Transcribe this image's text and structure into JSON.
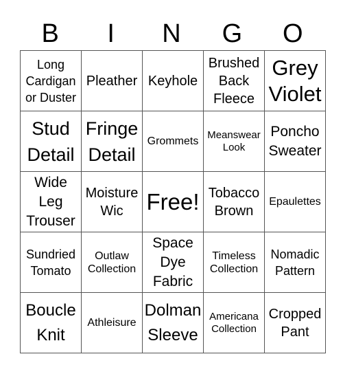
{
  "header": [
    "B",
    "I",
    "N",
    "G",
    "O"
  ],
  "rows": [
    [
      "Long Cardigan or Duster",
      "Pleather",
      "Keyhole",
      "Brushed Back Fleece",
      "Grey Violet"
    ],
    [
      "Stud Detail",
      "Fringe Detail",
      "Grommets",
      "Meanswear Look",
      "Poncho Sweater"
    ],
    [
      "Wide Leg Trouser",
      "Moisture Wic",
      "Free!",
      "Tobacco Brown",
      "Epaulettes"
    ],
    [
      "Sundried Tomato",
      "Outlaw Collection",
      "Space Dye Fabric",
      "Timeless Collection",
      "Nomadic Pattern"
    ],
    [
      "Boucle Knit",
      "Athleisure",
      "Dolman Sleeve",
      "Americana Collection",
      "Cropped Pant"
    ]
  ]
}
